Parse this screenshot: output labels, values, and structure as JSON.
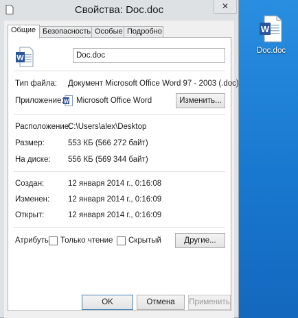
{
  "window": {
    "title": "Свойства: Doc.doc",
    "close_label": "✕"
  },
  "tabs": [
    {
      "label": "Общие",
      "active": true
    },
    {
      "label": "Безопасность",
      "active": false
    },
    {
      "label": "Особые",
      "active": false
    },
    {
      "label": "Подробно",
      "active": false
    }
  ],
  "general": {
    "file_name": "Doc.doc",
    "file_type_label": "Тип файла:",
    "file_type_value": "Документ Microsoft Office Word 97 - 2003 (.doc)",
    "app_label": "Приложение:",
    "app_value": "Microsoft Office Word",
    "change_button": "Изменить...",
    "location_label": "Расположение:",
    "location_value": "C:\\Users\\alex\\Desktop",
    "size_label": "Размер:",
    "size_value": "553 КБ (566 272 байт)",
    "disk_size_label": "На диске:",
    "disk_size_value": "556 КБ (569 344 байт)",
    "created_label": "Создан:",
    "created_value": "12 января 2014 г., 0:16:08",
    "modified_label": "Изменен:",
    "modified_value": "12 января 2014 г., 0:16:09",
    "accessed_label": "Открыт:",
    "accessed_value": "12 января 2014 г., 0:16:09",
    "attributes_label": "Атрибуты:",
    "readonly_label": "Только чтение",
    "readonly_checked": false,
    "hidden_label": "Скрытый",
    "hidden_checked": false,
    "other_button": "Другие..."
  },
  "footer": {
    "ok": "OK",
    "cancel": "Отмена",
    "apply": "Применить"
  },
  "desktop": {
    "icon_label": "Doc.doc"
  },
  "colors": {
    "desktop_bg": "#1878cf",
    "word_blue": "#2b579a",
    "window_bg": "#f0f0f0"
  }
}
